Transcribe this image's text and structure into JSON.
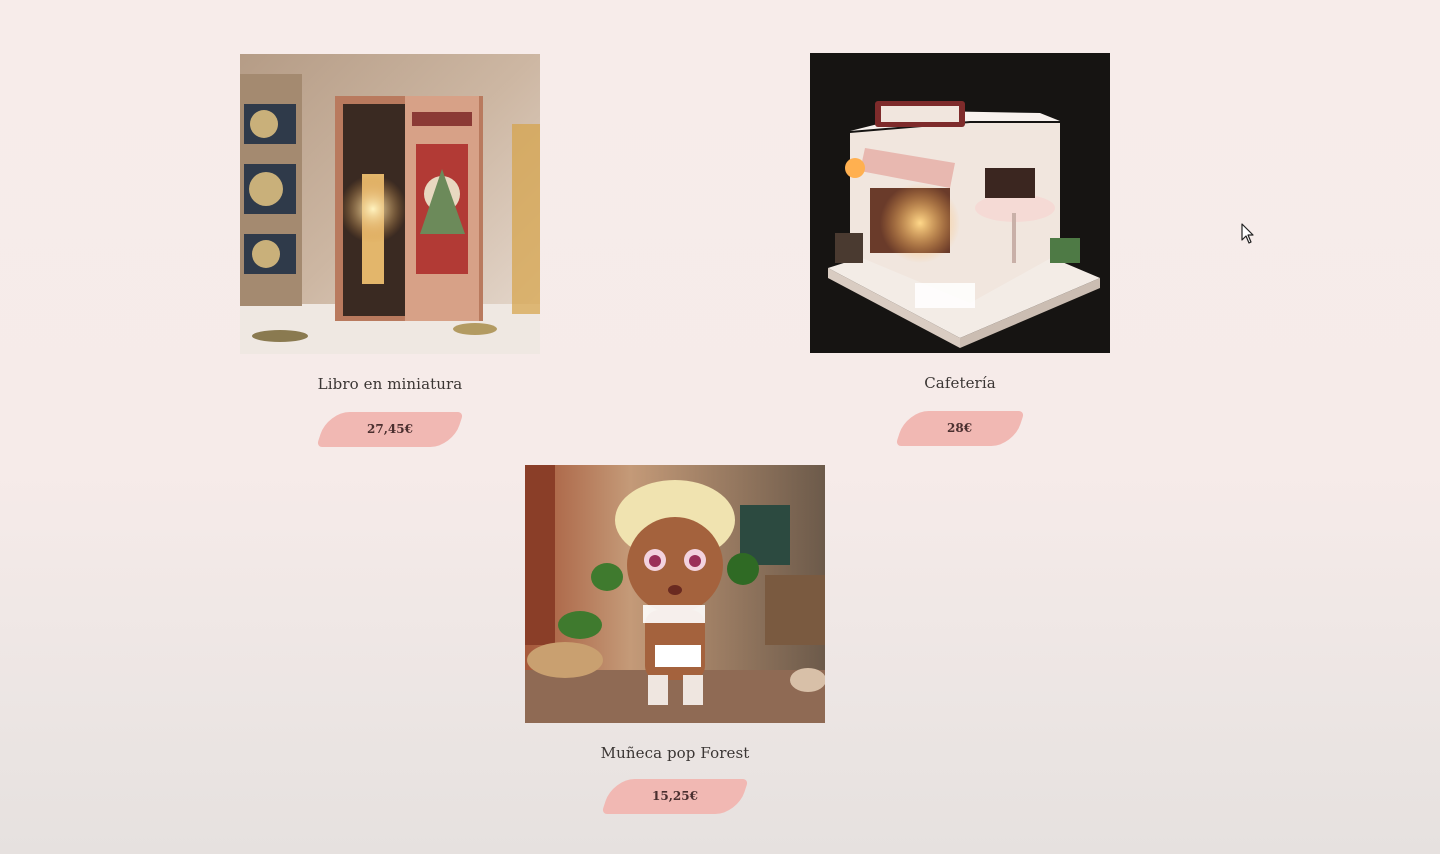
{
  "products": [
    {
      "name": "Libro en miniatura",
      "price": "27,45€",
      "image": "miniature-book-nook-image"
    },
    {
      "name": "Cafetería",
      "price": "28€",
      "image": "chocolate-shop-dollhouse-image"
    },
    {
      "name": "Muñeca pop Forest",
      "price": "15,25€",
      "image": "forest-pop-doll-image"
    }
  ],
  "colors": {
    "background": "#f7ecea",
    "price_pill": "#f1b8b3",
    "text": "#3b3634"
  },
  "icons": {
    "cursor": "mouse-pointer-icon"
  }
}
